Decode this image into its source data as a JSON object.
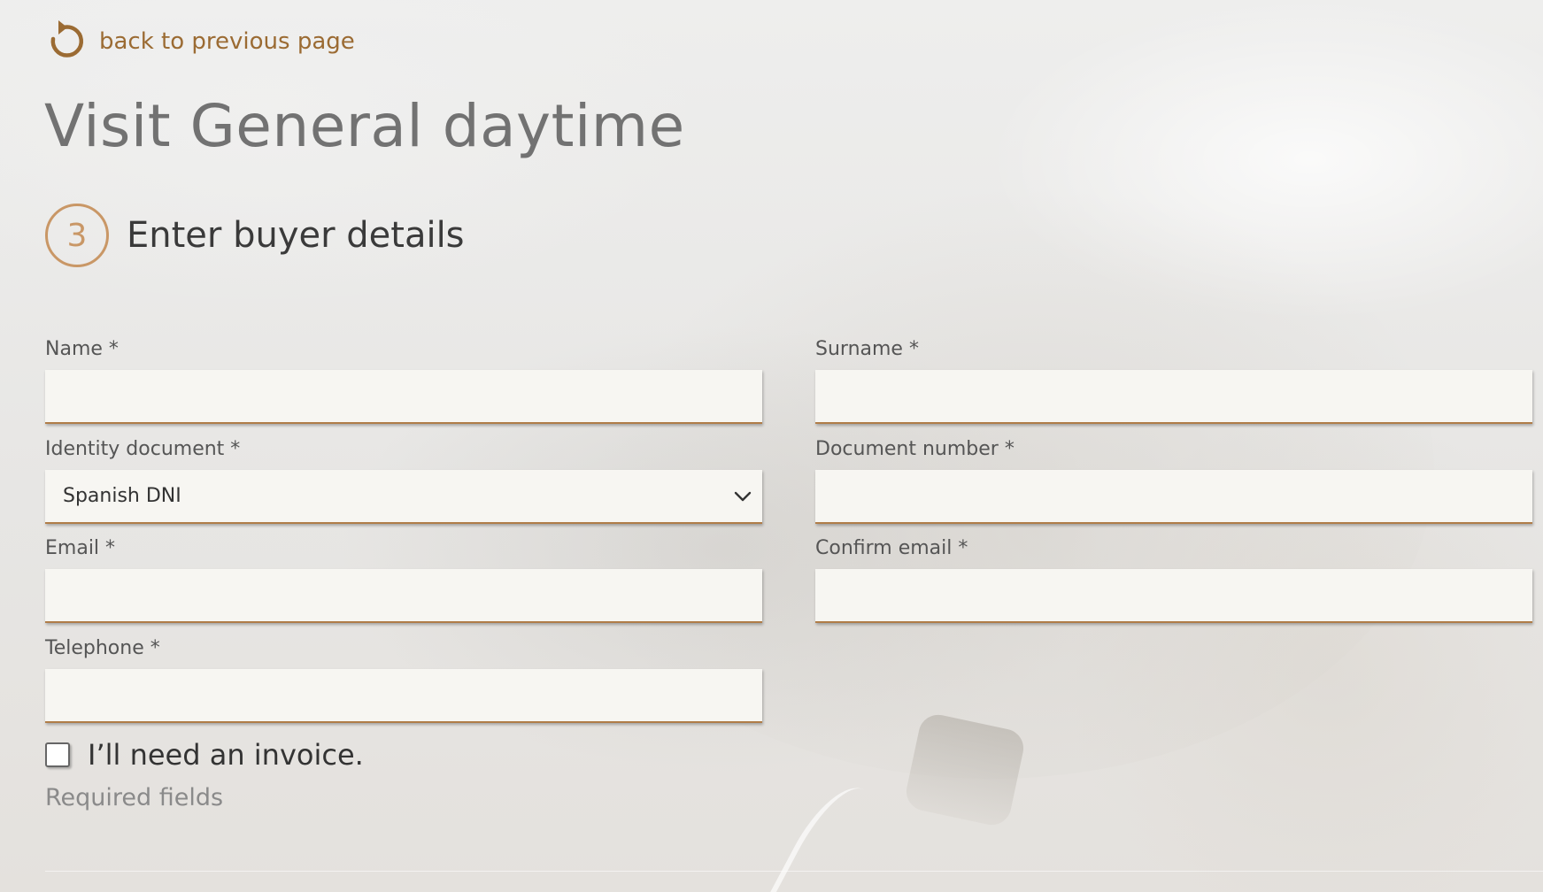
{
  "nav": {
    "back_label": "back to previous page"
  },
  "page": {
    "title": "Visit General daytime"
  },
  "step": {
    "number": "3",
    "title": "Enter buyer details"
  },
  "form": {
    "name": {
      "label": "Name *",
      "value": "",
      "placeholder": ""
    },
    "surname": {
      "label": "Surname *",
      "value": "",
      "placeholder": ""
    },
    "identity_document": {
      "label": "Identity document *",
      "selected": "Spanish DNI"
    },
    "document_number": {
      "label": "Document number *",
      "value": "",
      "placeholder": ""
    },
    "email": {
      "label": "Email *",
      "value": "",
      "placeholder": ""
    },
    "confirm_email": {
      "label": "Confirm email *",
      "value": "",
      "placeholder": ""
    },
    "telephone": {
      "label": "Telephone *",
      "value": "",
      "placeholder": ""
    },
    "invoice": {
      "label": "I’ll need an invoice.",
      "checked": false
    },
    "required_note": "Required fields"
  },
  "icons": {
    "back": "refresh-back-icon",
    "dropdown": "chevron-down-icon"
  },
  "colors": {
    "accent": "#9b6b33",
    "step_ring": "#c99766",
    "field_bg": "#f7f6f2",
    "field_border": "#b07d48"
  }
}
